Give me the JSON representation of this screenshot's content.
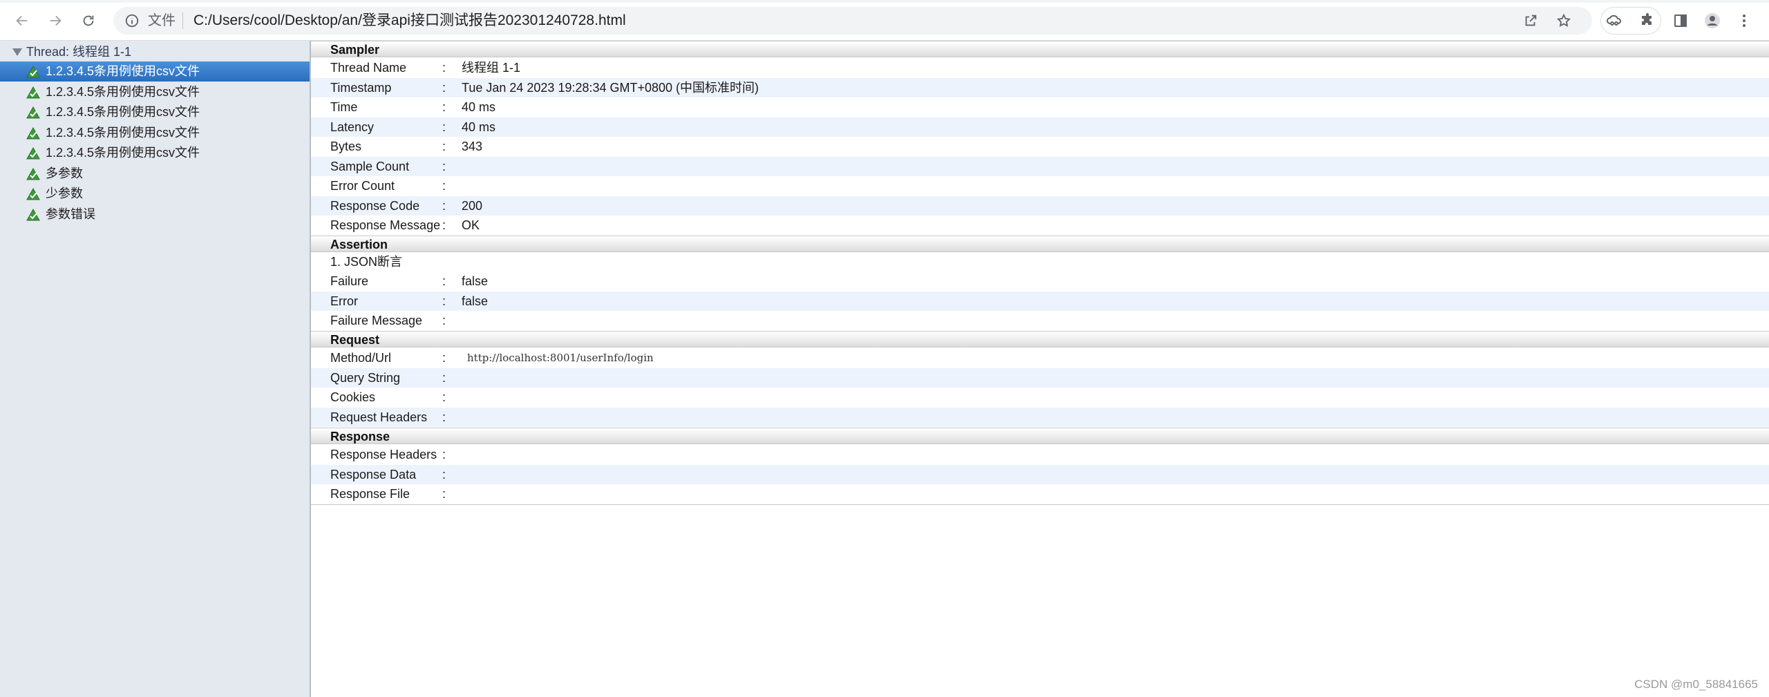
{
  "browser": {
    "scheme_label": "文件",
    "url": "C:/Users/cool/Desktop/an/登录api接口测试报告202301240728.html"
  },
  "tree": {
    "thread_label": "Thread: 线程组 1-1",
    "items": [
      {
        "label": "1.2.3.4.5条用例使用csv文件",
        "status": "success",
        "selected": true
      },
      {
        "label": "1.2.3.4.5条用例使用csv文件",
        "status": "success",
        "selected": false
      },
      {
        "label": "1.2.3.4.5条用例使用csv文件",
        "status": "success",
        "selected": false
      },
      {
        "label": "1.2.3.4.5条用例使用csv文件",
        "status": "success",
        "selected": false
      },
      {
        "label": "1.2.3.4.5条用例使用csv文件",
        "status": "success",
        "selected": false
      },
      {
        "label": "多参数",
        "status": "success",
        "selected": false
      },
      {
        "label": "少参数",
        "status": "success",
        "selected": false
      },
      {
        "label": "参数错误",
        "status": "success",
        "selected": false
      }
    ],
    "success_icon_color": "#3a9b3a"
  },
  "detail": {
    "sampler": {
      "title": "Sampler",
      "rows": [
        {
          "key": "Thread Name",
          "colon": ":",
          "value": "线程组 1-1"
        },
        {
          "key": "Timestamp",
          "colon": ":",
          "value": "Tue Jan 24 2023 19:28:34 GMT+0800 (中国标准时间)"
        },
        {
          "key": "Time",
          "colon": ":",
          "value": "40 ms"
        },
        {
          "key": "Latency",
          "colon": ":",
          "value": "40 ms"
        },
        {
          "key": "Bytes",
          "colon": ":",
          "value": "343"
        },
        {
          "key": "Sample Count",
          "colon": ":",
          "value": ""
        },
        {
          "key": "Error Count",
          "colon": ":",
          "value": ""
        },
        {
          "key": "Response Code",
          "colon": ":",
          "value": "200"
        },
        {
          "key": "Response Message",
          "colon": ":",
          "value": "OK"
        }
      ]
    },
    "assertion": {
      "title": "Assertion",
      "name": "1. JSON断言",
      "rows": [
        {
          "key": "Failure",
          "colon": ":",
          "value": "false"
        },
        {
          "key": "Error",
          "colon": ":",
          "value": "false"
        },
        {
          "key": "Failure Message",
          "colon": ":",
          "value": ""
        }
      ]
    },
    "request": {
      "title": "Request",
      "rows": [
        {
          "key": "Method/Url",
          "colon": ":",
          "value": "http://localhost:8001/userInfo/login"
        },
        {
          "key": "Query String",
          "colon": ":",
          "value": ""
        },
        {
          "key": "Cookies",
          "colon": ":",
          "value": ""
        },
        {
          "key": "Request Headers",
          "colon": ":",
          "value": ""
        }
      ]
    },
    "response": {
      "title": "Response",
      "rows": [
        {
          "key": "Response Headers",
          "colon": ":",
          "value": ""
        },
        {
          "key": "Response Data",
          "colon": ":",
          "value": ""
        },
        {
          "key": "Response File",
          "colon": ":",
          "value": ""
        }
      ]
    }
  },
  "watermark": "CSDN @m0_58841665"
}
